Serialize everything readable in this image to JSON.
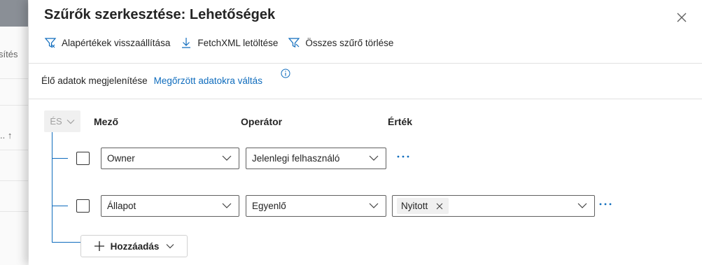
{
  "background": {
    "toolbar_fragment": "sítés",
    "sort_fragment": "..  ↑"
  },
  "panel": {
    "title": "Szűrők szerkesztése: Lehetőségek",
    "commands": {
      "reset_label": "Alapértékek visszaállítása",
      "download_label": "FetchXML letöltése",
      "clear_label": "Összes szűrő törlése"
    },
    "live": {
      "label": "Élő adatok megjelenítése",
      "link": "Megőrzött adatokra váltás"
    },
    "group": {
      "operator": "ÉS",
      "headers": {
        "field": "Mező",
        "operator": "Operátor",
        "value": "Érték"
      }
    },
    "rows": [
      {
        "field": "Owner",
        "operator": "Jelenlegi felhasználó"
      },
      {
        "field": "Állapot",
        "operator": "Egyenlő",
        "value_tag": "Nyitott"
      }
    ],
    "add_label": "Hozzáadás"
  },
  "colors": {
    "accent": "#0f6cbd",
    "text": "#242424",
    "border": "#616161"
  }
}
